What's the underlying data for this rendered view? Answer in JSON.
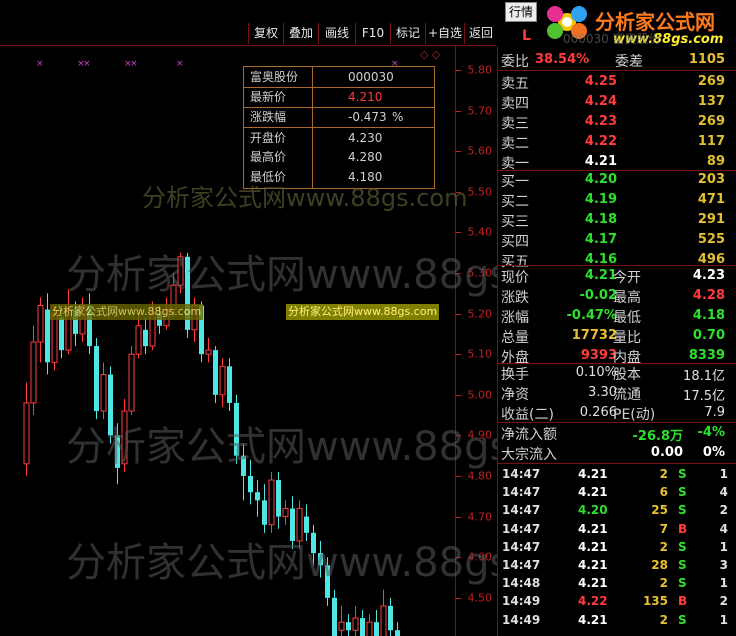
{
  "toolbar": {
    "tab_label": "行情",
    "buttons": [
      "复权",
      "叠加",
      "画线",
      "F10",
      "标记",
      "+自选",
      "返回"
    ]
  },
  "logo": {
    "title": "分析家公式网",
    "url": "www.88gs.com",
    "under_text": "000030 富奥股份"
  },
  "axis": {
    "labels": [
      "5.80",
      "5.70",
      "5.60",
      "5.50",
      "5.40",
      "5.30",
      "5.20",
      "5.10",
      "5.00",
      "4.90",
      "4.80",
      "4.70",
      "4.60",
      "4.50"
    ]
  },
  "info_box": {
    "name": "富奥股份",
    "code": "000030",
    "rows": [
      {
        "label": "最新价",
        "value": "4.210"
      },
      {
        "label": "涨跌幅",
        "value": "-0.473",
        "unit": "%"
      },
      {
        "label": "开盘价",
        "value": "4.230"
      },
      {
        "label": "最高价",
        "value": "4.280"
      },
      {
        "label": "最低价",
        "value": "4.180"
      }
    ]
  },
  "watermarks": {
    "small": "分析家公式网www.88gs.com",
    "big": "分析家公式网www.88gs.com",
    "faded": "分析家公式网www.88gs.com"
  },
  "panel": {
    "top_left": "委比",
    "top_ratio": "38.54%",
    "top_right": "委差",
    "top_diff": "1105",
    "L": "L",
    "sells": [
      {
        "label": "卖五",
        "price": "4.25",
        "vol": "269"
      },
      {
        "label": "卖四",
        "price": "4.24",
        "vol": "137"
      },
      {
        "label": "卖三",
        "price": "4.23",
        "vol": "269"
      },
      {
        "label": "卖二",
        "price": "4.22",
        "vol": "117"
      },
      {
        "label": "卖一",
        "price": "4.21",
        "vol": "89"
      }
    ],
    "buys": [
      {
        "label": "买一",
        "price": "4.20",
        "vol": "203"
      },
      {
        "label": "买二",
        "price": "4.19",
        "vol": "471"
      },
      {
        "label": "买三",
        "price": "4.18",
        "vol": "291"
      },
      {
        "label": "买四",
        "price": "4.17",
        "vol": "525"
      },
      {
        "label": "买五",
        "price": "4.16",
        "vol": "496"
      }
    ],
    "stats": [
      {
        "l1": "现价",
        "v1": "4.21",
        "l2": "今开",
        "v2": "4.23"
      },
      {
        "l1": "涨跌",
        "v1": "-0.02",
        "l2": "最高",
        "v2": "4.28"
      },
      {
        "l1": "涨幅",
        "v1": "-0.47%",
        "l2": "最低",
        "v2": "4.18"
      },
      {
        "l1": "总量",
        "v1": "17732",
        "l2": "量比",
        "v2": "0.70"
      },
      {
        "l1": "外盘",
        "v1": "9393",
        "l2": "内盘",
        "v2": "8339"
      }
    ],
    "fin": [
      {
        "l1": "换手",
        "v1": "0.10%",
        "l2": "股本",
        "v2": "18.1亿"
      },
      {
        "l1": "净资",
        "v1": "3.30",
        "l2": "流通",
        "v2": "17.5亿"
      },
      {
        "l1": "收益(二)",
        "v1": "0.266",
        "l2": "PE(动)",
        "v2": "7.9"
      }
    ],
    "flow": [
      {
        "label": "净流入额",
        "v1": "-26.8万",
        "v2": "-4%"
      },
      {
        "label": "大宗流入",
        "v1": "0.00",
        "v2": "0%"
      }
    ],
    "ticks": [
      {
        "time": "14:47",
        "price": "4.21",
        "vol": "2",
        "side": "S",
        "n": "1"
      },
      {
        "time": "14:47",
        "price": "4.21",
        "vol": "6",
        "side": "S",
        "n": "4"
      },
      {
        "time": "14:47",
        "price": "4.20",
        "vol": "25",
        "side": "S",
        "n": "2"
      },
      {
        "time": "14:47",
        "price": "4.21",
        "vol": "7",
        "side": "B",
        "n": "4"
      },
      {
        "time": "14:47",
        "price": "4.21",
        "vol": "2",
        "side": "S",
        "n": "1"
      },
      {
        "time": "14:47",
        "price": "4.21",
        "vol": "28",
        "side": "S",
        "n": "3"
      },
      {
        "time": "14:48",
        "price": "4.21",
        "vol": "2",
        "side": "S",
        "n": "1"
      },
      {
        "time": "14:49",
        "price": "4.22",
        "vol": "135",
        "side": "B",
        "n": "2"
      },
      {
        "time": "14:49",
        "price": "4.21",
        "vol": "2",
        "side": "S",
        "n": "1"
      }
    ]
  },
  "colors": {
    "up": "#ff3b3b",
    "down": "#2ee02e",
    "neutral": "#ffffff",
    "cyan": "#4fe6e6",
    "yellow": "#e8c030"
  }
}
